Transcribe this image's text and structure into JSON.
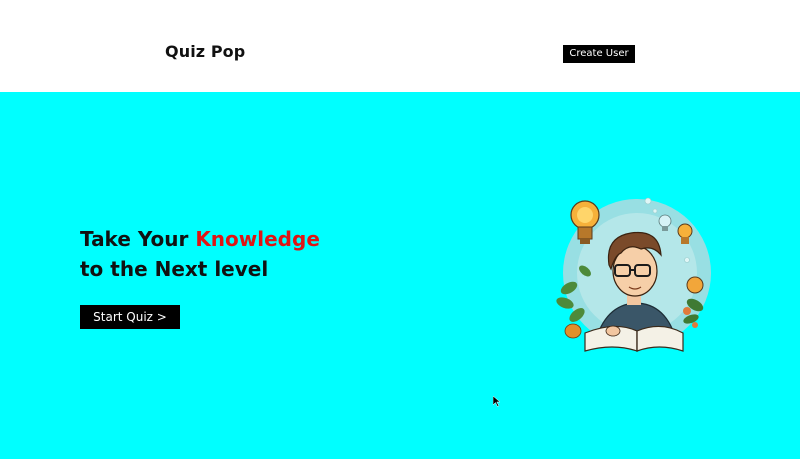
{
  "header": {
    "brand": "Quiz Pop",
    "create_user_label": "Create User"
  },
  "hero": {
    "headline_part1": "Take Your ",
    "headline_accent": "Knowledge",
    "headline_line2": "to the Next level",
    "start_label": "Start Quiz >",
    "illustration": "student-reading-book-illustration"
  },
  "colors": {
    "hero_bg": "#00ffff",
    "accent": "#e01414",
    "button_bg": "#000000"
  }
}
